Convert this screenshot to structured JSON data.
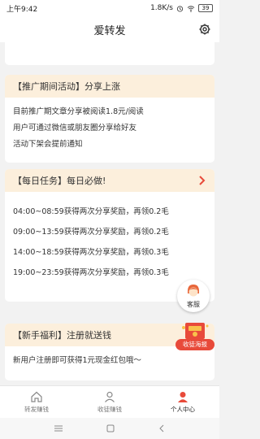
{
  "status": {
    "time": "上午9:42",
    "net": "1.8K/s",
    "battery": "39"
  },
  "header": {
    "title": "爱转发"
  },
  "card1": {
    "head": "【推广期间活动】分享上涨",
    "lines": [
      "目前推广期文章分享被阅读1.8元/阅读",
      "用户可通过微信或朋友圈分享给好友",
      "活动下架会提前通知"
    ]
  },
  "card2": {
    "head": "【每日任务】每日必做!",
    "lines": [
      "04:00~08:59获得两次分享奖励，再领0.2毛",
      "09:00~13:59获得两次分享奖励，再领0.2毛",
      "14:00~18:59获得两次分享奖励，再领0.3毛",
      "19:00~23:59获得两次分享奖励，再领0.3毛"
    ]
  },
  "card3": {
    "head": "【新手福利】注册就送钱",
    "lines": [
      "新用户注册即可获得1元现金红包哦～"
    ]
  },
  "float": {
    "cs_label": "客服",
    "promo_label": "收徒海报"
  },
  "tabs": [
    {
      "label": "转发赚钱",
      "icon": "home-icon"
    },
    {
      "label": "收徒赚钱",
      "icon": "person-icon"
    },
    {
      "label": "个人中心",
      "icon": "profile-icon"
    }
  ],
  "colors": {
    "card_head_bg": "#fcefdc",
    "accent": "#e84a3a"
  }
}
